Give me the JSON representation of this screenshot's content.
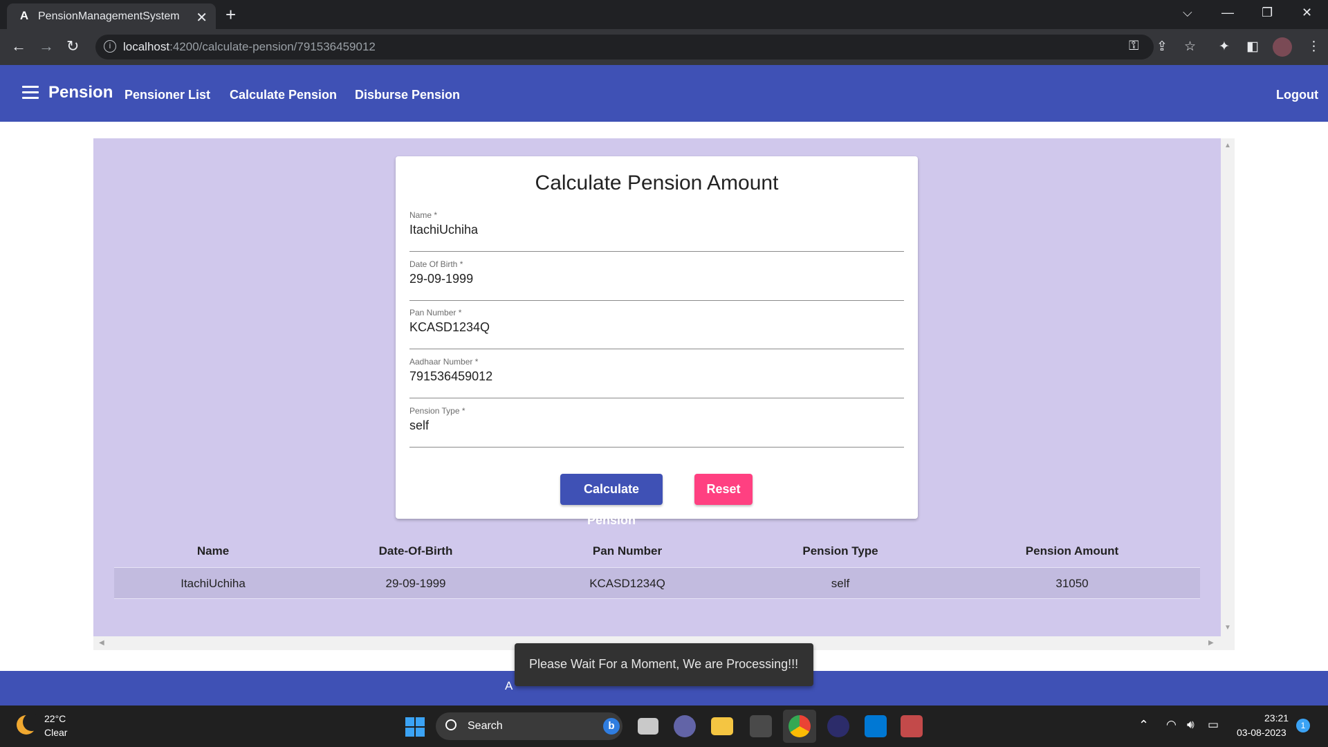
{
  "browser": {
    "tab_title": "PensionManagementSystem",
    "favicon": "A",
    "url_host": "localhost",
    "url_path": ":4200/calculate-pension/791536459012"
  },
  "toolbar": {
    "brand": "Pension",
    "nav": [
      "Pensioner List",
      "Calculate Pension",
      "Disburse Pension"
    ],
    "logout": "Logout"
  },
  "form": {
    "title": "Calculate Pension Amount",
    "fields": [
      {
        "label": "Name *",
        "value": "ItachiUchiha"
      },
      {
        "label": "Date Of Birth *",
        "value": "29-09-1999"
      },
      {
        "label": "Pan Number *",
        "value": "KCASD1234Q"
      },
      {
        "label": "Aadhaar Number *",
        "value": "791536459012"
      },
      {
        "label": "Pension Type *",
        "value": "self"
      }
    ],
    "calculate_label": "Calculate Pension",
    "reset_label": "Reset"
  },
  "table": {
    "headers": [
      "Name",
      "Date-Of-Birth",
      "Pan Number",
      "Pension Type",
      "Pension Amount"
    ],
    "rows": [
      [
        "ItachiUchiha",
        "29-09-1999",
        "KCASD1234Q",
        "self",
        "31050"
      ]
    ]
  },
  "footer": {
    "text_fragment": "A"
  },
  "snackbar": {
    "message": "Please Wait For a Moment, We are Processing!!!"
  },
  "taskbar": {
    "temperature": "22°C",
    "condition": "Clear",
    "search_label": "Search",
    "time": "23:21",
    "date": "03-08-2023",
    "notification_count": "1"
  },
  "colors": {
    "primary": "#3f51b5",
    "accent": "#ff4081",
    "panel": "#d0c8ec"
  }
}
